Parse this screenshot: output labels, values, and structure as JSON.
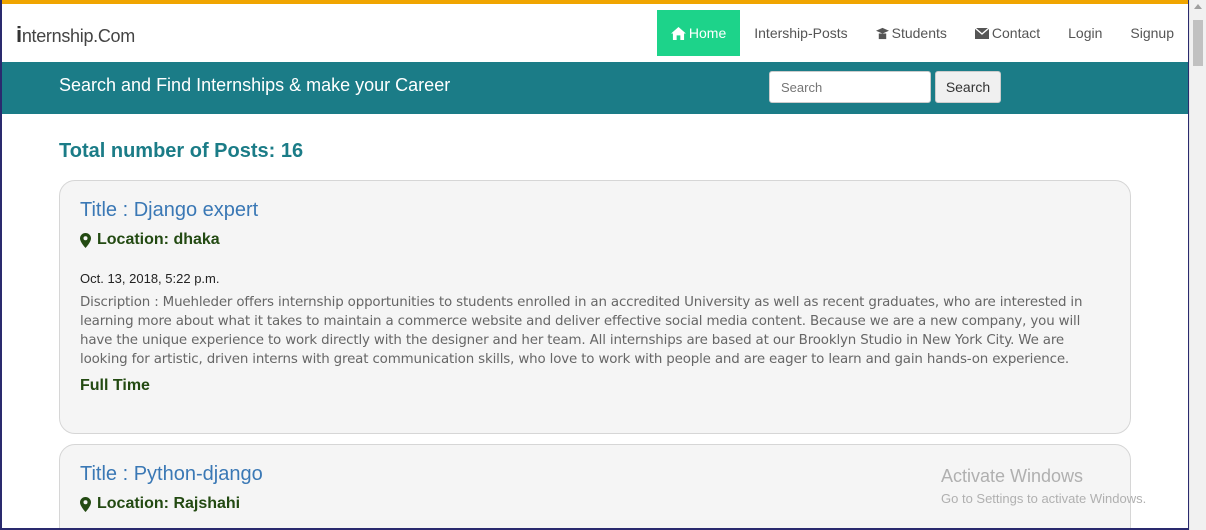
{
  "brand": {
    "initial": "i",
    "rest": "nternship.Com"
  },
  "nav": {
    "home": "Home",
    "posts": "Intership-Posts",
    "students": "Students",
    "contact": "Contact",
    "login": "Login",
    "signup": "Signup"
  },
  "hero": {
    "title": "Search and Find Internships & make your Career",
    "search_placeholder": "Search",
    "search_button": "Search"
  },
  "total_posts": "Total number of Posts: 16",
  "posts": [
    {
      "title": "Title : Django expert",
      "location": "Location: dhaka",
      "date": "Oct. 13, 2018, 5:22 p.m.",
      "description": "Discription : Muehleder offers internship opportunities to students enrolled in an accredited University as well as recent graduates, who are interested in learning more about what it takes to maintain a commerce website and deliver effective social media content. Because we are a new company, you will have the unique experience to work directly with the designer and her team. All internships are based at our Brooklyn Studio in New York City. We are looking for artistic, driven interns with great communication skills, who love to work with people and are eager to learn and gain hands-on experience.",
      "type": "Full Time"
    },
    {
      "title": "Title : Python-django",
      "location": "Location: Rajshahi"
    }
  ],
  "watermark": {
    "title": "Activate Windows",
    "subtitle": "Go to Settings to activate Windows."
  },
  "colors": {
    "accent": "#f0a500",
    "nav_active": "#1dd38a",
    "hero_bg": "#1b7c87",
    "title_blue": "#3a78b5",
    "location_green": "#234a12"
  }
}
